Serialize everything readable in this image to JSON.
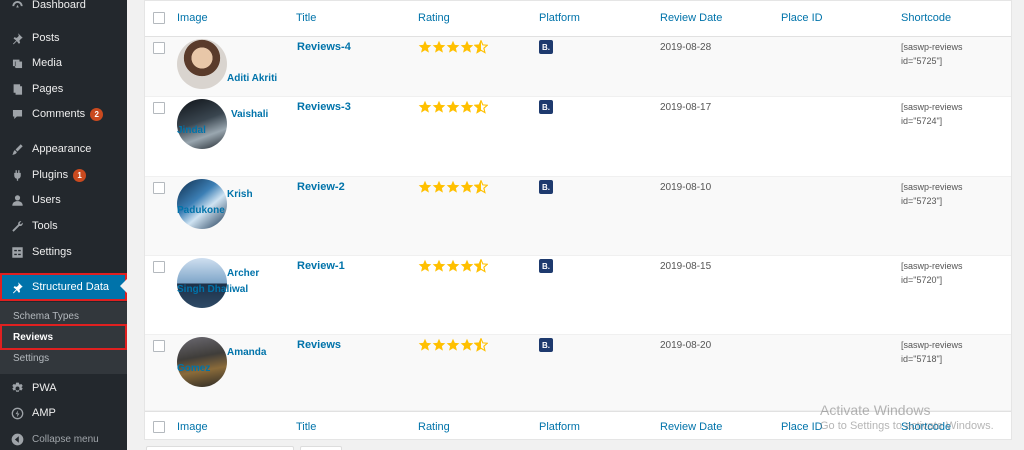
{
  "sidebar": {
    "dashboard": "Dashboard",
    "posts": "Posts",
    "media": "Media",
    "pages": "Pages",
    "comments": "Comments",
    "comments_badge": "2",
    "appearance": "Appearance",
    "plugins": "Plugins",
    "plugins_badge": "1",
    "users": "Users",
    "tools": "Tools",
    "settings": "Settings",
    "structured_data": "Structured Data",
    "submenu": {
      "schema_types": "Schema Types",
      "reviews": "Reviews",
      "settings": "Settings"
    },
    "pwa": "PWA",
    "amp": "AMP",
    "collapse": "Collapse menu"
  },
  "table": {
    "columns": [
      "Image",
      "Title",
      "Rating",
      "Platform",
      "Review Date",
      "Place ID",
      "Shortcode"
    ],
    "rows": [
      {
        "name1": "Aditi Akriti",
        "name2": "",
        "title": "Reviews-4",
        "rating": 4.5,
        "platform": "B.",
        "date": "2019-08-28",
        "place_id": "",
        "shortcode1": "[saswp-reviews",
        "shortcode2": "id=\"5725\"]"
      },
      {
        "name1": "Vaishali",
        "name2": "Jindal",
        "title": "Reviews-3",
        "rating": 4.5,
        "platform": "B.",
        "date": "2019-08-17",
        "place_id": "",
        "shortcode1": "[saswp-reviews",
        "shortcode2": "id=\"5724\"]"
      },
      {
        "name1": "Krish",
        "name2": "Padukone",
        "title": "Review-2",
        "rating": 4.5,
        "platform": "B.",
        "date": "2019-08-10",
        "place_id": "",
        "shortcode1": "[saswp-reviews",
        "shortcode2": "id=\"5723\"]"
      },
      {
        "name1": "Archer",
        "name2": "Singh Dhaliwal",
        "title": "Review-1",
        "rating": 4.5,
        "platform": "B.",
        "date": "2019-08-15",
        "place_id": "",
        "shortcode1": "[saswp-reviews",
        "shortcode2": "id=\"5720\"]"
      },
      {
        "name1": "Amanda",
        "name2": "Gomez",
        "title": "Reviews",
        "rating": 4.5,
        "platform": "B.",
        "date": "2019-08-20",
        "place_id": "",
        "shortcode1": "[saswp-reviews",
        "shortcode2": "id=\"5718\"]"
      }
    ]
  },
  "watermark": {
    "line1": "Activate Windows",
    "line2": "Go to Settings to activate Windows."
  },
  "colors": {
    "sidebar_bg": "#23282d",
    "accent": "#0073aa",
    "star": "#ffc000",
    "platform_badge": "#1e3a6e",
    "highlight_outline": "#e02020"
  }
}
